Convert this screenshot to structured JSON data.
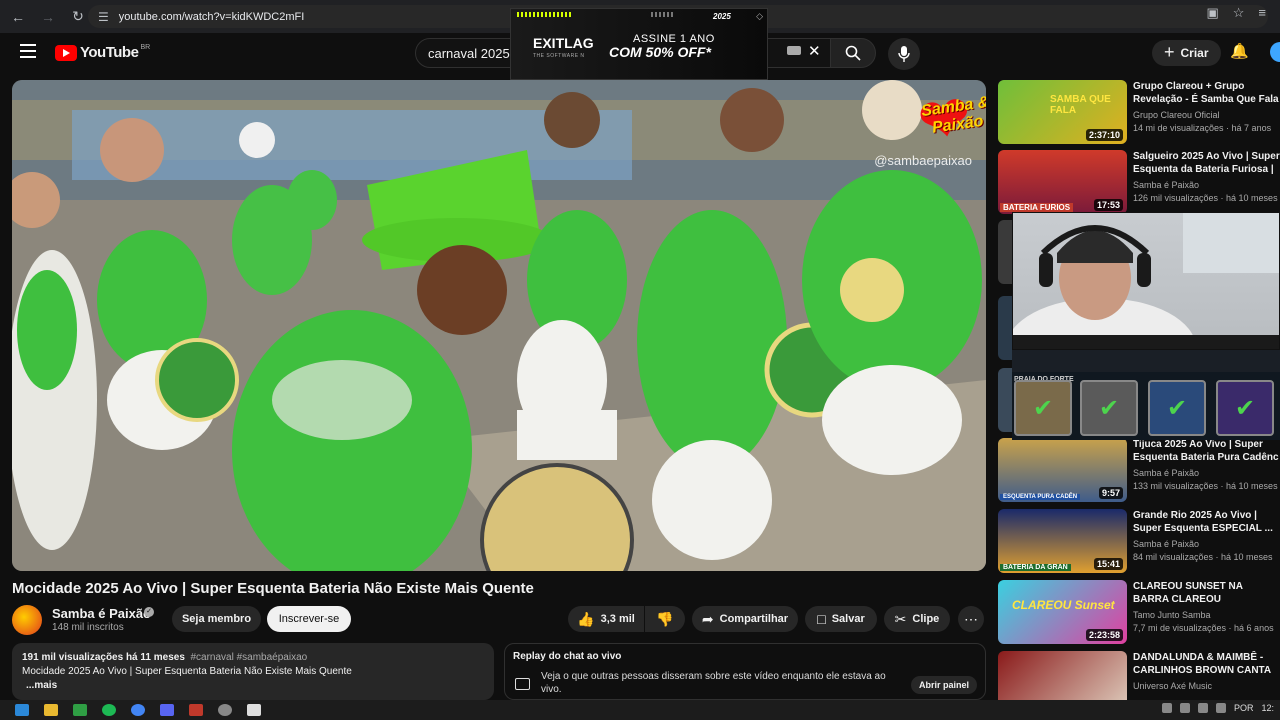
{
  "browser": {
    "url": "youtube.com/watch?v=kidKWDC2mFI"
  },
  "header": {
    "logo_text": "YouTube",
    "country_code": "BR",
    "search_value": "carnaval 2025",
    "create_label": "Criar"
  },
  "ad": {
    "year": "2025",
    "brand": "EXITLAG",
    "brand_sub": "THE SOFTWARE N",
    "line1": "ASSINE 1 ANO",
    "line2": "COM 50% OFF*"
  },
  "video": {
    "watermark": "Samba & Paixão",
    "handle": "@sambaepaixao",
    "title": "Mocidade 2025 Ao Vivo | Super Esquenta Bateria Não Existe Mais Quente"
  },
  "channel": {
    "name": "Samba é Paixão",
    "subscribers": "148 mil inscritos",
    "member_label": "Seja membro",
    "subscribe_label": "Inscrever-se"
  },
  "actions": {
    "likes": "3,3 mil",
    "share": "Compartilhar",
    "save": "Salvar",
    "clip": "Clipe"
  },
  "description": {
    "views_date": "191 mil visualizações  há 11 meses",
    "tags": "#carnaval #sambaépaixao",
    "text": "Mocidade 2025 Ao Vivo |  Super Esquenta Bateria Não Existe Mais Quente",
    "more": "...mais"
  },
  "chat": {
    "title": "Replay do chat ao vivo",
    "text": "Veja o que outras pessoas disseram sobre este vídeo enquanto ele estava ao vivo.",
    "open_label": "Abrir painel"
  },
  "recommendations": [
    {
      "title": "Grupo Clareou + Grupo Revelação - É Samba Que Fala",
      "channel": "Grupo Clareou Oficial",
      "meta": "14 mi de visualizações · há 7 anos",
      "duration": "2:37:10",
      "thumb_text": "SAMBA QUE FALA"
    },
    {
      "title": "Salgueiro 2025 Ao Vivo | Super Esquenta da Bateria Furiosa | ...",
      "channel": "Samba é Paixão",
      "meta": "126 mil visualizações · há 10 meses",
      "duration": "17:53",
      "thumb_text": "BATERIA FURIOS"
    },
    {
      "title": "Tijuca 2025 Ao Vivo |  Super Esquenta Bateria Pura Cadênc",
      "channel": "Samba é Paixão",
      "meta": "133 mil visualizações · há 10 meses",
      "duration": "9:57",
      "thumb_text": "ESQUENTA PURA CADÊN"
    },
    {
      "title": "Grande Rio 2025 Ao Vivo | Super Esquenta ESPECIAL ...",
      "channel": "Samba é Paixão",
      "meta": "84 mil visualizações · há 10 meses",
      "duration": "15:41",
      "thumb_text": "BATERIA DA GRAN"
    },
    {
      "title": "CLAREOU SUNSET NA BARRA CLAREOU",
      "channel": "Tamo Junto Samba",
      "meta": "7,7 mi de visualizações · há 6 anos",
      "duration": "2:23:58",
      "thumb_text": "CLAREOU Sunset"
    },
    {
      "title": "DANDALUNDA & MAIMBÊ - CARLINHOS BROWN CANTA ...",
      "channel": "Universo Axé Music",
      "meta": "",
      "duration": "",
      "thumb_text": ""
    }
  ],
  "overlay": {
    "label": "PRAIA DO FORTE"
  },
  "taskbar": {
    "lang": "POR",
    "time": "12:"
  },
  "colors": {
    "accent_red": "#ff0000",
    "jersey_green": "#3fbf3f",
    "background": "#0f0f0f"
  }
}
